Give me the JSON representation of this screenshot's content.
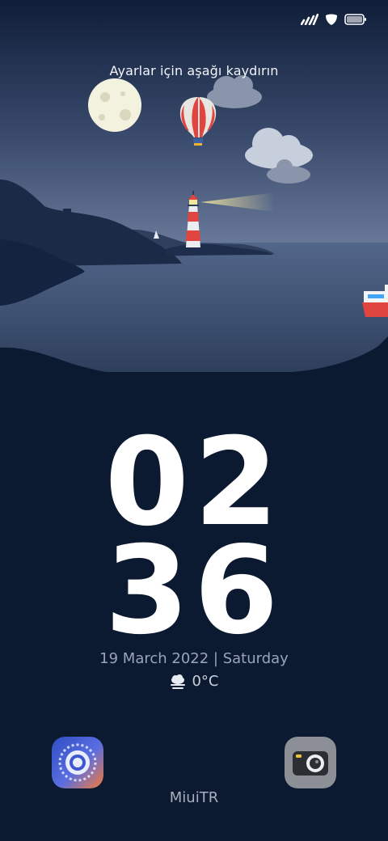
{
  "status_bar": {
    "signal_icon": "signal-icon",
    "vpn_icon": "shield-icon",
    "battery_icon": "battery-icon"
  },
  "lockscreen": {
    "hint": "Ayarlar için aşağı kaydırın",
    "clock": {
      "hours": "02",
      "minutes": "36"
    },
    "date": "19 March 2022 | Saturday",
    "weather": {
      "icon": "cloud-fog-icon",
      "temperature": "0°C"
    },
    "carrier": "MiuiTR",
    "shortcuts": {
      "left_icon": "control-center-icon",
      "right_icon": "camera-icon"
    }
  },
  "colors": {
    "sky_top": "#0f1d38",
    "sky_bottom": "#5a6c8e",
    "sea": "#435777",
    "ground": "#0c1a31",
    "lighthouse_red": "#e0463f",
    "camera_bg": "#8c9096"
  }
}
